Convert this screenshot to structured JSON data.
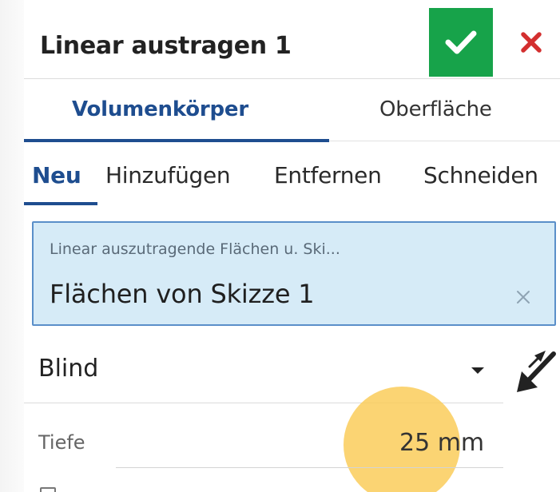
{
  "dialog": {
    "title": "Linear austragen 1",
    "confirm_icon": "checkmark-icon",
    "cancel_icon": "close-icon",
    "confirm_color": "#17a34a",
    "cancel_color": "#d32f2f"
  },
  "body_type_tabs": [
    {
      "label": "Volumenkörper",
      "active": true
    },
    {
      "label": "Oberfläche",
      "active": false
    }
  ],
  "operation_tabs": [
    {
      "label": "Neu",
      "active": true
    },
    {
      "label": "Hinzufügen",
      "active": false
    },
    {
      "label": "Entfernen",
      "active": false
    },
    {
      "label": "Schneiden",
      "active": false
    }
  ],
  "selection": {
    "label": "Linear auszutragende Flächen u. Ski...",
    "value": "Flächen von Skizze 1",
    "clear_icon": "close-icon",
    "background": "#d6ebf7",
    "border": "#5a8fc9"
  },
  "end_type": {
    "value": "Blind",
    "dropdown_icon": "caret-down-icon",
    "flip_icon": "flip-direction-arrow-icon"
  },
  "depth": {
    "label": "Tiefe",
    "value": "25 mm"
  },
  "accent_color": "#1e4d8f",
  "highlight_color": "#facd5a"
}
